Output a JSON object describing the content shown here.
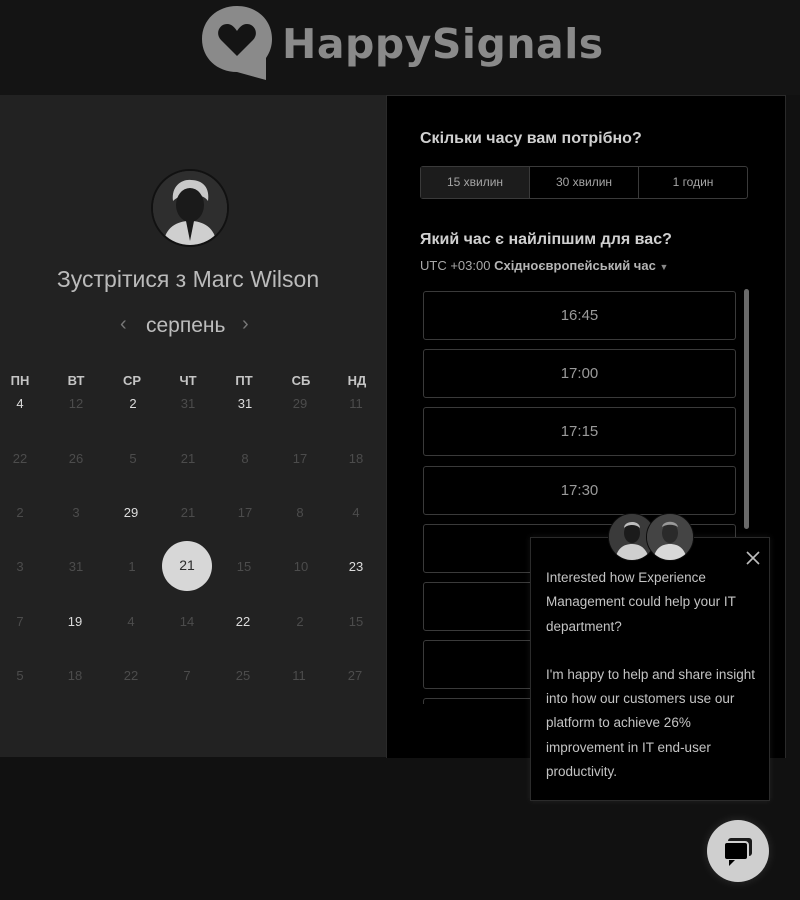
{
  "brand": {
    "name": "HappySignals",
    "logo_icon": "heart-speech-bubble-icon"
  },
  "calendar": {
    "meet_prefix": "Зустрітися з",
    "host_name": "Marc Wilson",
    "month": "серпень",
    "weekdays": [
      "ПН",
      "ВТ",
      "СР",
      "ЧТ",
      "ПТ",
      "СБ",
      "НД"
    ],
    "days": [
      [
        "4",
        "12",
        "2",
        "31",
        "31",
        "29",
        "11"
      ],
      [
        "22",
        "26",
        "5",
        "21",
        "8",
        "17",
        "18"
      ],
      [
        "2",
        "3",
        "29",
        "21",
        "17",
        "8",
        "4"
      ],
      [
        "3",
        "31",
        "1",
        "21",
        "15",
        "10",
        "23"
      ],
      [
        "7",
        "19",
        "4",
        "14",
        "22",
        "2",
        "15"
      ],
      [
        "5",
        "18",
        "22",
        "7",
        "25",
        "11",
        "27"
      ]
    ],
    "selected_day": "21"
  },
  "booking": {
    "duration_question": "Скільки часу вам потрібно?",
    "durations": [
      "15 хвилин",
      "30 хвилин",
      "1 годин"
    ],
    "active_duration": "15 хвилин",
    "time_question": "Який час є найліпшим для вас?",
    "tz_offset": "UTC +03:00",
    "tz_name": "Східноєвропейський час",
    "slots": [
      "16:45",
      "17:00",
      "17:15",
      "17:30",
      "",
      "",
      "",
      ""
    ]
  },
  "popup": {
    "line1": "Interested how Experience Management could help your IT department?",
    "line2": "I'm happy to help and share insight into how our customers use our platform to achieve 26% improvement in IT end-user productivity."
  },
  "colors": {
    "background": "#111111",
    "panel_left": "#222222",
    "panel_right": "#000000",
    "selected_day": "#d7d7d7"
  }
}
